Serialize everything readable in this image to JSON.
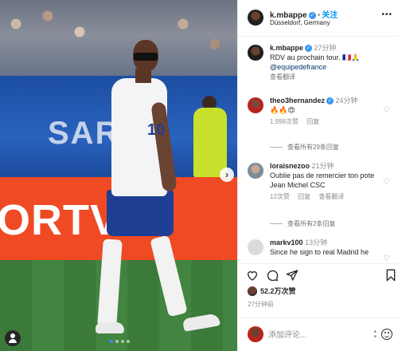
{
  "photo": {
    "blue_banner_text": "SAR",
    "orange_banner_text": "ORTVIE",
    "shirt_number": "10",
    "carousel_dots": 4,
    "carousel_active": 0
  },
  "header": {
    "username": "k.mbappe",
    "separator": "•",
    "follow_label": "关注",
    "location": "Düsseldorf, Germany",
    "more": "•••"
  },
  "caption": {
    "username": "k.mbappe",
    "time": "27分钟",
    "text": "RDV au prochain tour. 🇫🇷🙏",
    "mention": "@equipedefrance",
    "translate": "查看翻译"
  },
  "comments": [
    {
      "username": "theo3hernandez",
      "time": "24分钟",
      "text": "🔥🔥😍",
      "likes": "1,998次赞",
      "reply": "回复",
      "view_replies": "查看所有29条回复"
    },
    {
      "username": "loraisnezoo",
      "time": "21分钟",
      "text": "Oublie pas de remercier ton pote Jean Michel CSC",
      "likes": "12次赞",
      "reply": "回复",
      "translate": "查看翻译",
      "view_replies": "查看所有2条回复"
    },
    {
      "username": "markv100",
      "time": "13分钟",
      "text": "Since he sign to real Madrid he"
    }
  ],
  "likes": {
    "count_label": "52.2万次赞"
  },
  "post_time": "27分钟前",
  "add_comment": {
    "placeholder": "添加评论..."
  },
  "colors": {
    "link": "#00376b",
    "follow": "#0095f6",
    "verified": "#3897f0",
    "muted": "#8e8e8e"
  }
}
